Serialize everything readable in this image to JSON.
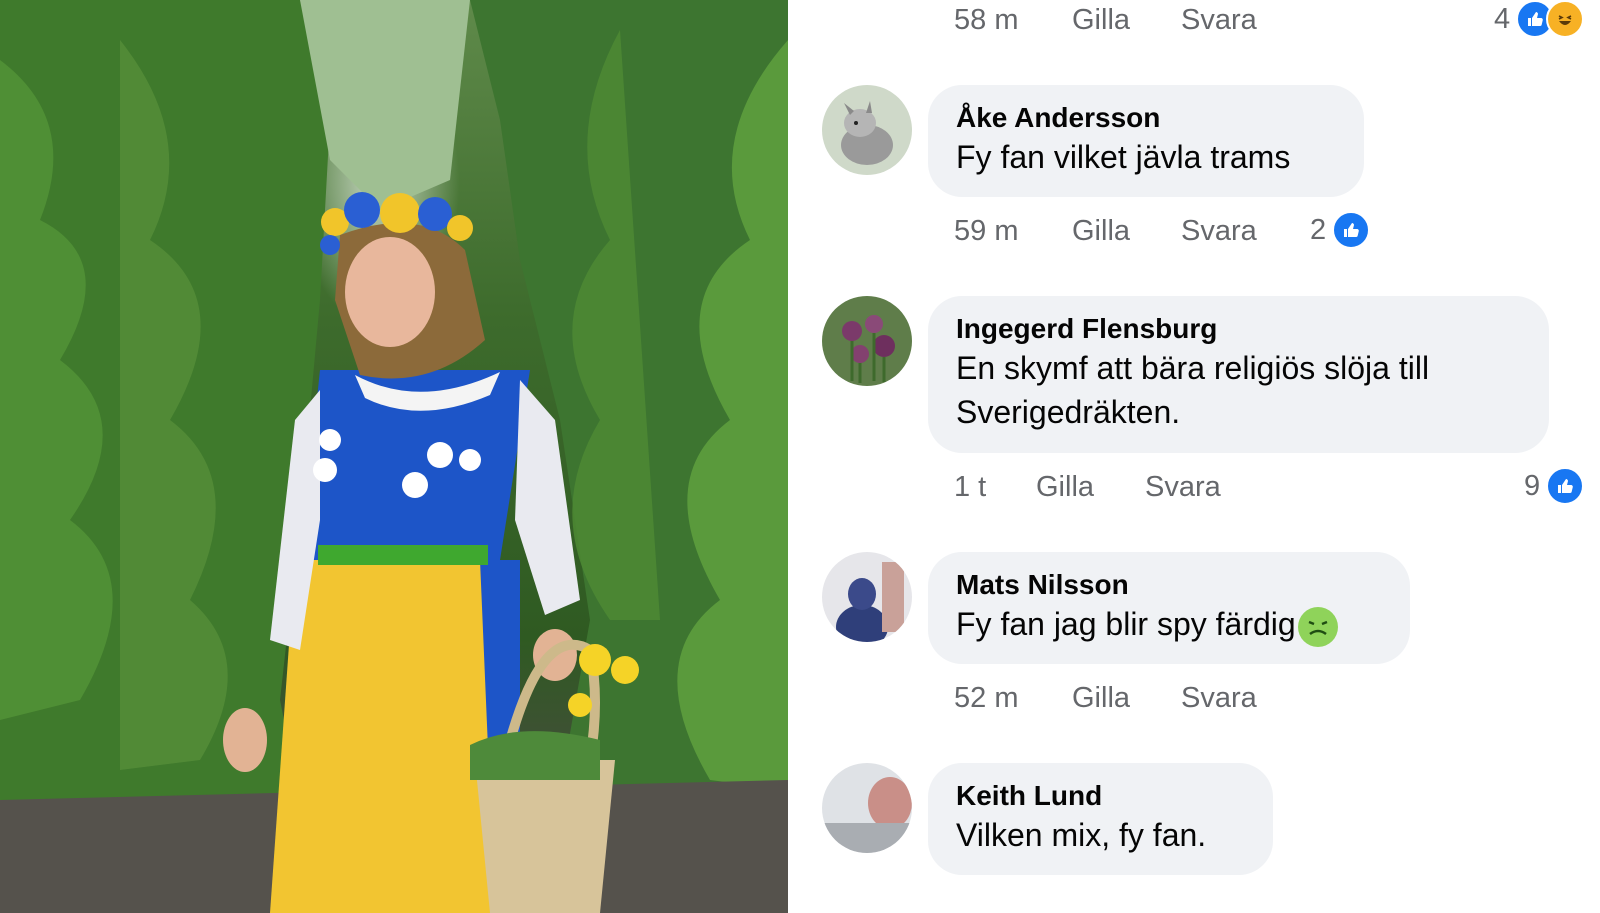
{
  "colors": {
    "bubble_bg": "#f0f2f5",
    "meta_text": "#65676b",
    "like_blue": "#1877f2",
    "haha_yellow": "#f7b125"
  },
  "top_row": {
    "time": "58 m",
    "like": "Gilla",
    "reply": "Svara",
    "reaction_count": "4"
  },
  "comments": [
    {
      "author": "Åke Andersson",
      "text": "Fy fan vilket jävla trams",
      "time": "59 m",
      "like": "Gilla",
      "reply": "Svara",
      "reaction_count": "2"
    },
    {
      "author": "Ingegerd Flensburg",
      "text_line1": "En skymf att bära religiös slöja till",
      "text_line2": "Sverigedräkten.",
      "time": "1 t",
      "like": "Gilla",
      "reply": "Svara",
      "reaction_count": "9"
    },
    {
      "author": "Mats Nilsson",
      "text": "Fy fan jag blir spy färdig",
      "time": "52 m",
      "like": "Gilla",
      "reply": "Svara"
    },
    {
      "author": "Keith Lund",
      "text": "Vilken mix, fy fan."
    }
  ],
  "icons": {
    "like": "thumbs-up-icon",
    "haha": "haha-reaction-icon",
    "sick": "nauseated-face-emoji"
  }
}
